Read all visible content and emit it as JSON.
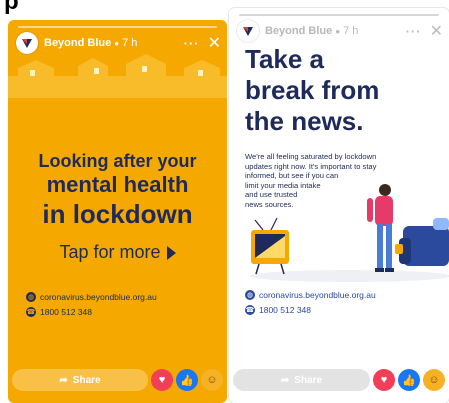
{
  "top_text": "p",
  "stories": [
    {
      "brand": "Beyond Blue",
      "time": "7 h",
      "headline": [
        "Looking after your",
        "mental health",
        "in lockdown"
      ],
      "tap": "Tap for more",
      "contacts": [
        {
          "icon": "globe-icon",
          "text": "coronavirus.beyondblue.org.au"
        },
        {
          "icon": "phone-icon",
          "text": "1800 512 348"
        }
      ],
      "share": "Share",
      "colors": {
        "background": "#f5a800",
        "text": "#1e2a5a"
      }
    },
    {
      "brand": "Beyond Blue",
      "time": "7 h",
      "headline": [
        "Take a",
        "break from",
        "the news."
      ],
      "body": [
        "We're all feeling saturated by lockdown",
        "updates right now. It's important to stay",
        "informed, but see if you can",
        "limit your media intake",
        "and use trusted",
        "news sources."
      ],
      "contacts": [
        {
          "icon": "globe-icon",
          "text": "coronavirus.beyondblue.org.au"
        },
        {
          "icon": "phone-icon",
          "text": "1800 512 348"
        }
      ],
      "share": "Share",
      "colors": {
        "background": "#ffffff",
        "text": "#1e2a5a",
        "accent": "#2b4a9e"
      }
    }
  ]
}
